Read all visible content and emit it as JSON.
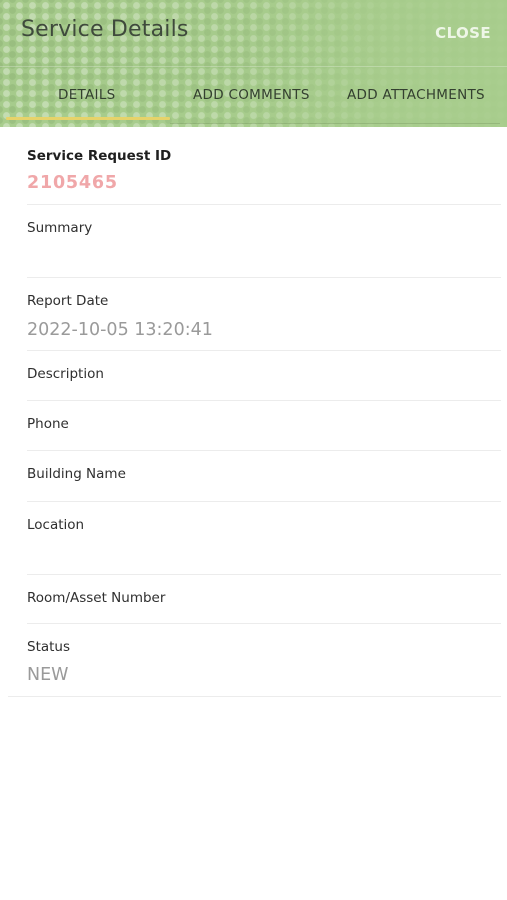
{
  "header": {
    "title": "Service Details",
    "close_label": "CLOSE",
    "colors": {
      "header_bg": "#a9cf8e",
      "tab_indicator": "#e6d36a"
    }
  },
  "tabs": [
    {
      "label": "DETAILS",
      "active": true
    },
    {
      "label": "ADD COMMENTS",
      "active": false
    },
    {
      "label": "ADD ATTACHMENTS",
      "active": false
    }
  ],
  "fields": {
    "service_request_id": {
      "label": "Service Request ID",
      "value": "2105465",
      "value_color": "#f0a7a9"
    },
    "summary": {
      "label": "Summary",
      "value": ""
    },
    "report_date": {
      "label": "Report Date",
      "value": "2022-10-05 13:20:41"
    },
    "description": {
      "label": "Description",
      "value": ""
    },
    "phone": {
      "label": "Phone",
      "value": ""
    },
    "building_name": {
      "label": "Building Name",
      "value": ""
    },
    "location": {
      "label": "Location",
      "value": ""
    },
    "room_asset_number": {
      "label": "Room/Asset Number",
      "value": ""
    },
    "status": {
      "label": "Status",
      "value": "NEW"
    }
  }
}
